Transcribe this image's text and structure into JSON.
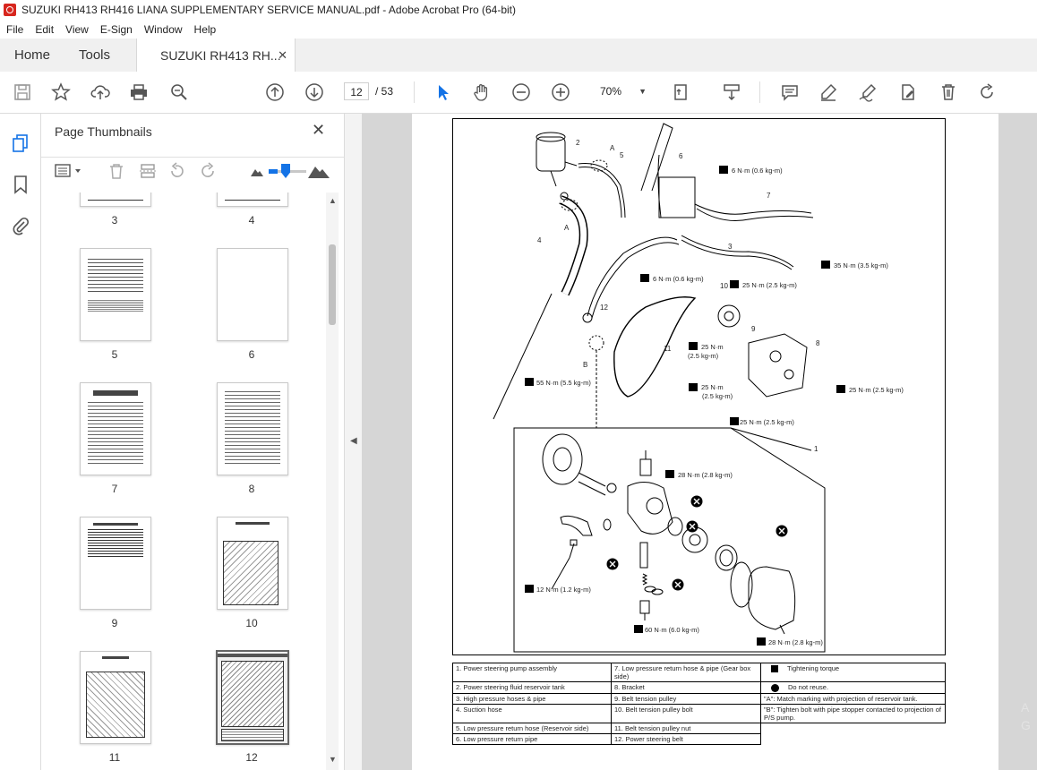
{
  "window": {
    "title": "SUZUKI RH413 RH416 LIANA SUPPLEMENTARY SERVICE MANUAL.pdf - Adobe Acrobat Pro (64-bit)"
  },
  "menu": [
    "File",
    "Edit",
    "View",
    "E-Sign",
    "Window",
    "Help"
  ],
  "tabs": {
    "home": "Home",
    "tools": "Tools",
    "document": "SUZUKI RH413 RH..."
  },
  "toolbar": {
    "page_current": "12",
    "page_total": "/ 53",
    "zoom": "70%"
  },
  "sidebar": {
    "panel_title": "Page Thumbnails",
    "thumbnails": [
      {
        "label": "3"
      },
      {
        "label": "4"
      },
      {
        "label": "5"
      },
      {
        "label": "6"
      },
      {
        "label": "7"
      },
      {
        "label": "8"
      },
      {
        "label": "9"
      },
      {
        "label": "10"
      },
      {
        "label": "11"
      },
      {
        "label": "12"
      }
    ]
  },
  "diagram": {
    "callouts": {
      "c2": "2",
      "c5": "5",
      "c6": "6",
      "c7": "7",
      "c3": "3",
      "c4": "4",
      "c12": "12",
      "c10": "10",
      "c9": "9",
      "c8": "8",
      "c11": "11",
      "c1": "1",
      "cA1": "A",
      "cA2": "A",
      "cB": "B"
    },
    "torques": {
      "t1": "6 N·m (0.6 kg-m)",
      "t2": "35 N·m (3.5 kg-m)",
      "t3": "6 N·m (0.6 kg-m)",
      "t4": "25 N·m (2.5 kg-m)",
      "t5a": "25 N·m",
      "t5b": "(2.5 kg-m)",
      "t6a": "25 N·m",
      "t6b": "(2.5 kg-m)",
      "t7": "25 N·m (2.5 kg-m)",
      "t8": "25 N·m (2.5 kg-m)",
      "t9": "55 N·m (5.5 kg-m)",
      "t10": "28 N·m (2.8 kg-m)",
      "t11": "12 N·m (1.2 kg-m)",
      "t12": "60 N·m (6.0 kg-m)",
      "t13": "28 N·m (2.8 kg-m)"
    }
  },
  "legend": {
    "rows": [
      {
        "a": "1.   Power steering pump assembly",
        "b": "7.   Low pressure return hose & pipe (Gear box side)",
        "c": "Tightening torque"
      },
      {
        "a": "2.   Power steering fluid reservoir tank",
        "b": "8.   Bracket",
        "c": "Do not reuse."
      },
      {
        "a": "3.   High pressure hoses & pipe",
        "b": "9.   Belt tension pulley",
        "c": "\"A\":   Match marking with projection of reservoir tank."
      },
      {
        "a": "4.   Suction hose",
        "b": "10.  Belt tension pulley bolt",
        "c": "\"B\":   Tighten bolt with pipe stopper contacted to projection of P/S pump."
      },
      {
        "a": "5.   Low pressure return hose (Reservoir side)",
        "b": "11.  Belt tension pulley nut",
        "c": ""
      },
      {
        "a": "6.   Low pressure return pipe",
        "b": "12.  Power steering belt",
        "c": ""
      }
    ]
  },
  "overlay": {
    "text": "A\nG"
  }
}
